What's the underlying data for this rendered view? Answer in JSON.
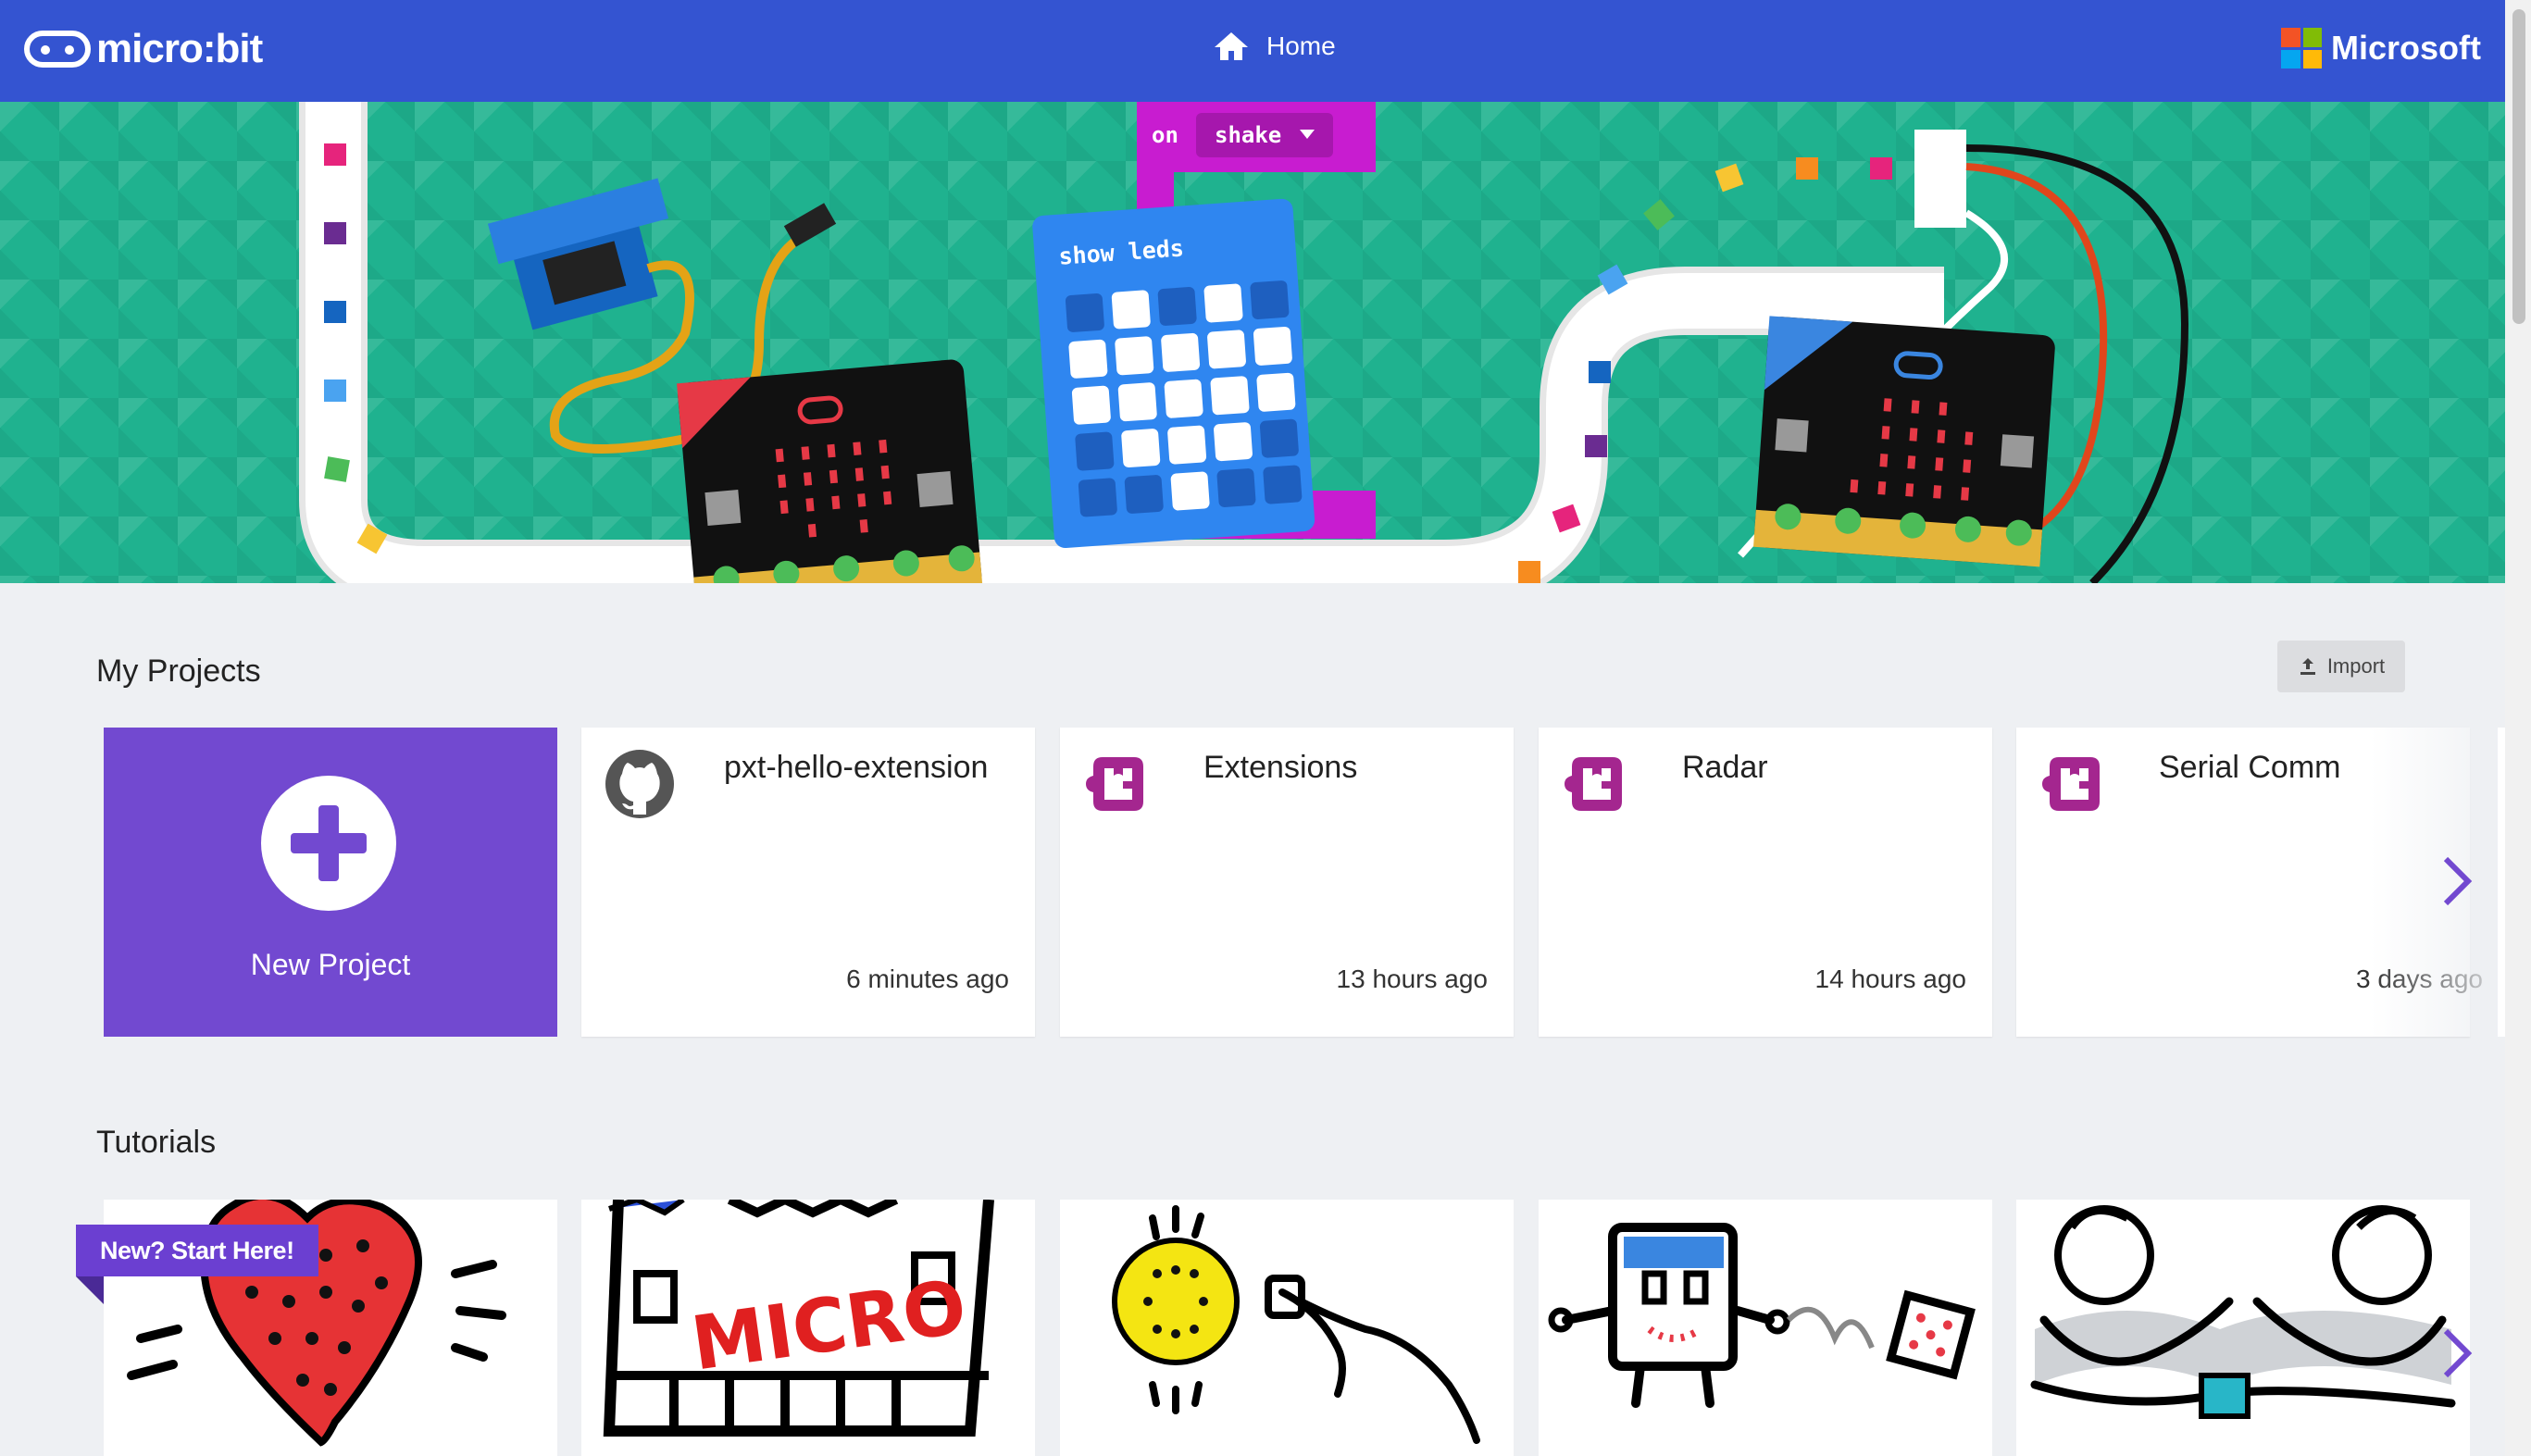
{
  "header": {
    "logo_text": "micro:bit",
    "nav_home": "Home",
    "brand": "Microsoft"
  },
  "hero": {
    "block_event": "on",
    "block_dropdown": "shake",
    "block_show": "show leds"
  },
  "my_projects": {
    "title": "My Projects",
    "import_label": "Import",
    "new_project_label": "New Project",
    "items": [
      {
        "title": "pxt-hello-extension",
        "time": "6 minutes ago",
        "icon": "github-icon"
      },
      {
        "title": "Extensions",
        "time": "13 hours ago",
        "icon": "makecode-icon"
      },
      {
        "title": "Radar",
        "time": "14 hours ago",
        "icon": "makecode-icon"
      },
      {
        "title": "Serial Comm",
        "time": "3 days ago",
        "icon": "makecode-icon"
      }
    ]
  },
  "tutorials": {
    "title": "Tutorials",
    "badge": "New? Start Here!"
  },
  "colors": {
    "header": "#3454d1",
    "hero": "#1fb28f",
    "accent_purple": "#7249d0",
    "makecode_icon": "#a4268f"
  }
}
